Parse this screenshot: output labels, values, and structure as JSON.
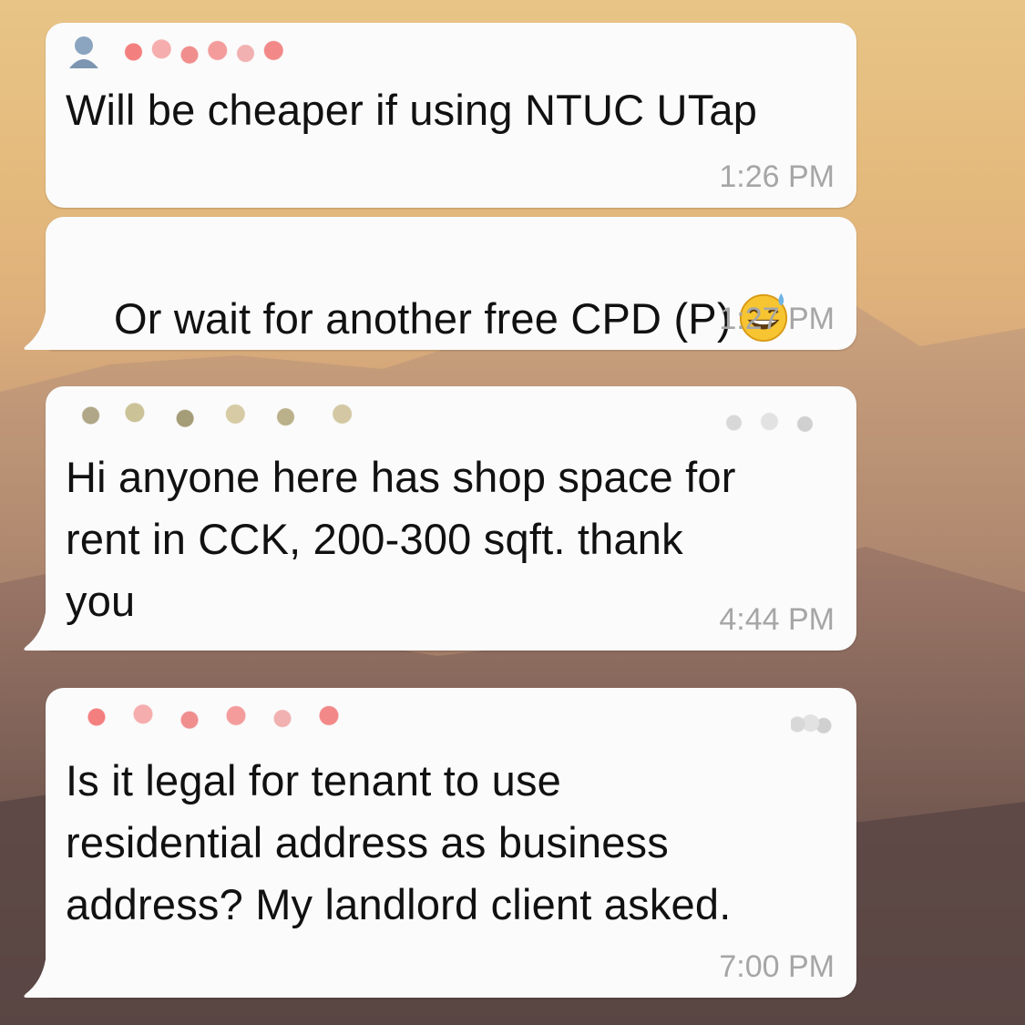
{
  "messages": [
    {
      "text": "Will be cheaper if using NTUC UTap",
      "time": "1:26 PM"
    },
    {
      "text": "Or wait for another free CPD (P)",
      "time": "1:27 PM",
      "emoji": "grinning-sweat-emoji"
    },
    {
      "text": "Hi anyone here has shop space for\nrent in CCK, 200-300 sqft. thank\nyou",
      "time": "4:44 PM"
    },
    {
      "text": "Is it legal for tenant to use\nresidential address as business\naddress? My landlord client asked.",
      "time": "7:00 PM"
    }
  ],
  "colors": {
    "bubble": "#fbfbfb",
    "text": "#111111",
    "timestamp": "#a6a6a6",
    "redacted_red": "#f26a6a",
    "redacted_tan": "#b3a87d",
    "avatar": "#6f8fb0"
  },
  "icons": [
    "avatar-icon",
    "grinning-sweat-emoji"
  ]
}
